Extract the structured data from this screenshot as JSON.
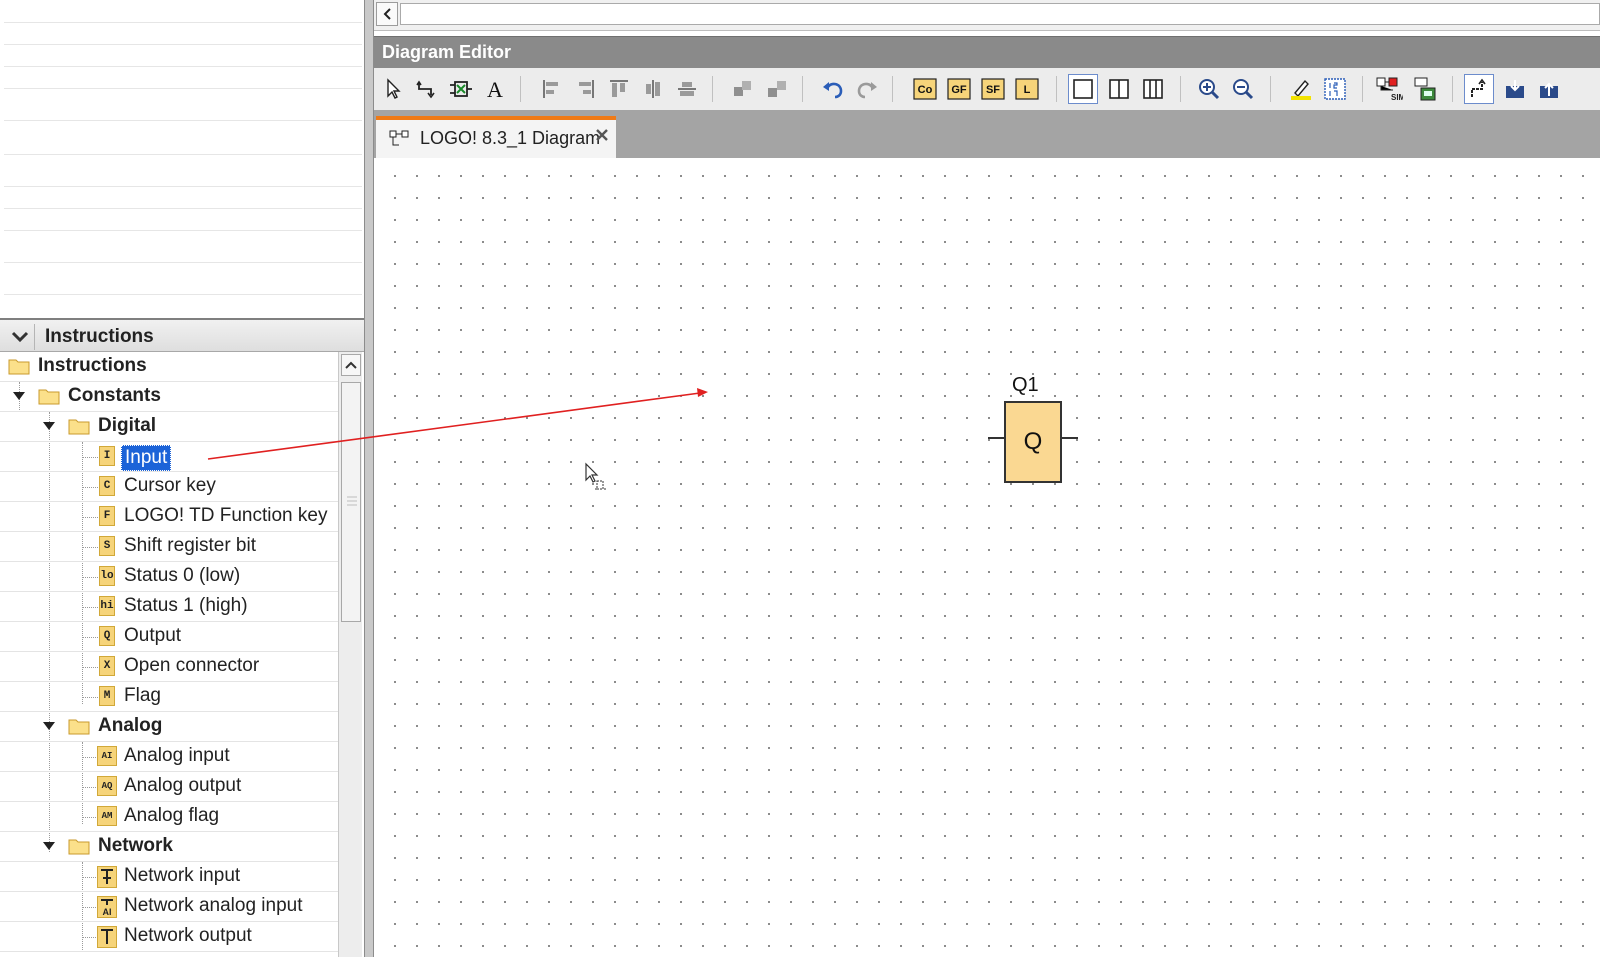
{
  "left_panel": {
    "instructions_header": "Instructions",
    "tree": {
      "root": "Instructions",
      "constants": "Constants",
      "digital": {
        "label": "Digital",
        "items": [
          {
            "icon": "I",
            "label": "Input"
          },
          {
            "icon": "C",
            "label": "Cursor key"
          },
          {
            "icon": "F",
            "label": "LOGO! TD Function key"
          },
          {
            "icon": "S",
            "label": "Shift register bit"
          },
          {
            "icon": "lo",
            "label": "Status 0 (low)"
          },
          {
            "icon": "hi",
            "label": "Status 1 (high)"
          },
          {
            "icon": "Q",
            "label": "Output"
          },
          {
            "icon": "X",
            "label": "Open connector"
          },
          {
            "icon": "M",
            "label": "Flag"
          }
        ]
      },
      "analog": {
        "label": "Analog",
        "items": [
          {
            "icon": "AI",
            "label": "Analog input"
          },
          {
            "icon": "AQ",
            "label": "Analog output"
          },
          {
            "icon": "AM",
            "label": "Analog flag"
          }
        ]
      },
      "network": {
        "label": "Network",
        "items": [
          {
            "icon": "network-input-icon",
            "label": "Network input"
          },
          {
            "icon": "network-analog-input-icon",
            "label": "Network analog input"
          },
          {
            "icon": "network-output-icon",
            "label": "Network output"
          }
        ]
      }
    }
  },
  "editor": {
    "title": "Diagram Editor",
    "tab": {
      "label": "LOGO! 8.3_1 Diagram"
    },
    "toolbar": {
      "text_buttons": [
        "Co",
        "GF",
        "SF",
        "L"
      ]
    },
    "diagram": {
      "block": {
        "name": "Q1",
        "symbol": "Q"
      }
    }
  },
  "colors": {
    "selection": "#1c63d8",
    "block_fill": "#fad892",
    "tab_accent": "#ef7a16",
    "annotation_arrow": "#e02020",
    "title_bar": "#8a8a8a"
  }
}
